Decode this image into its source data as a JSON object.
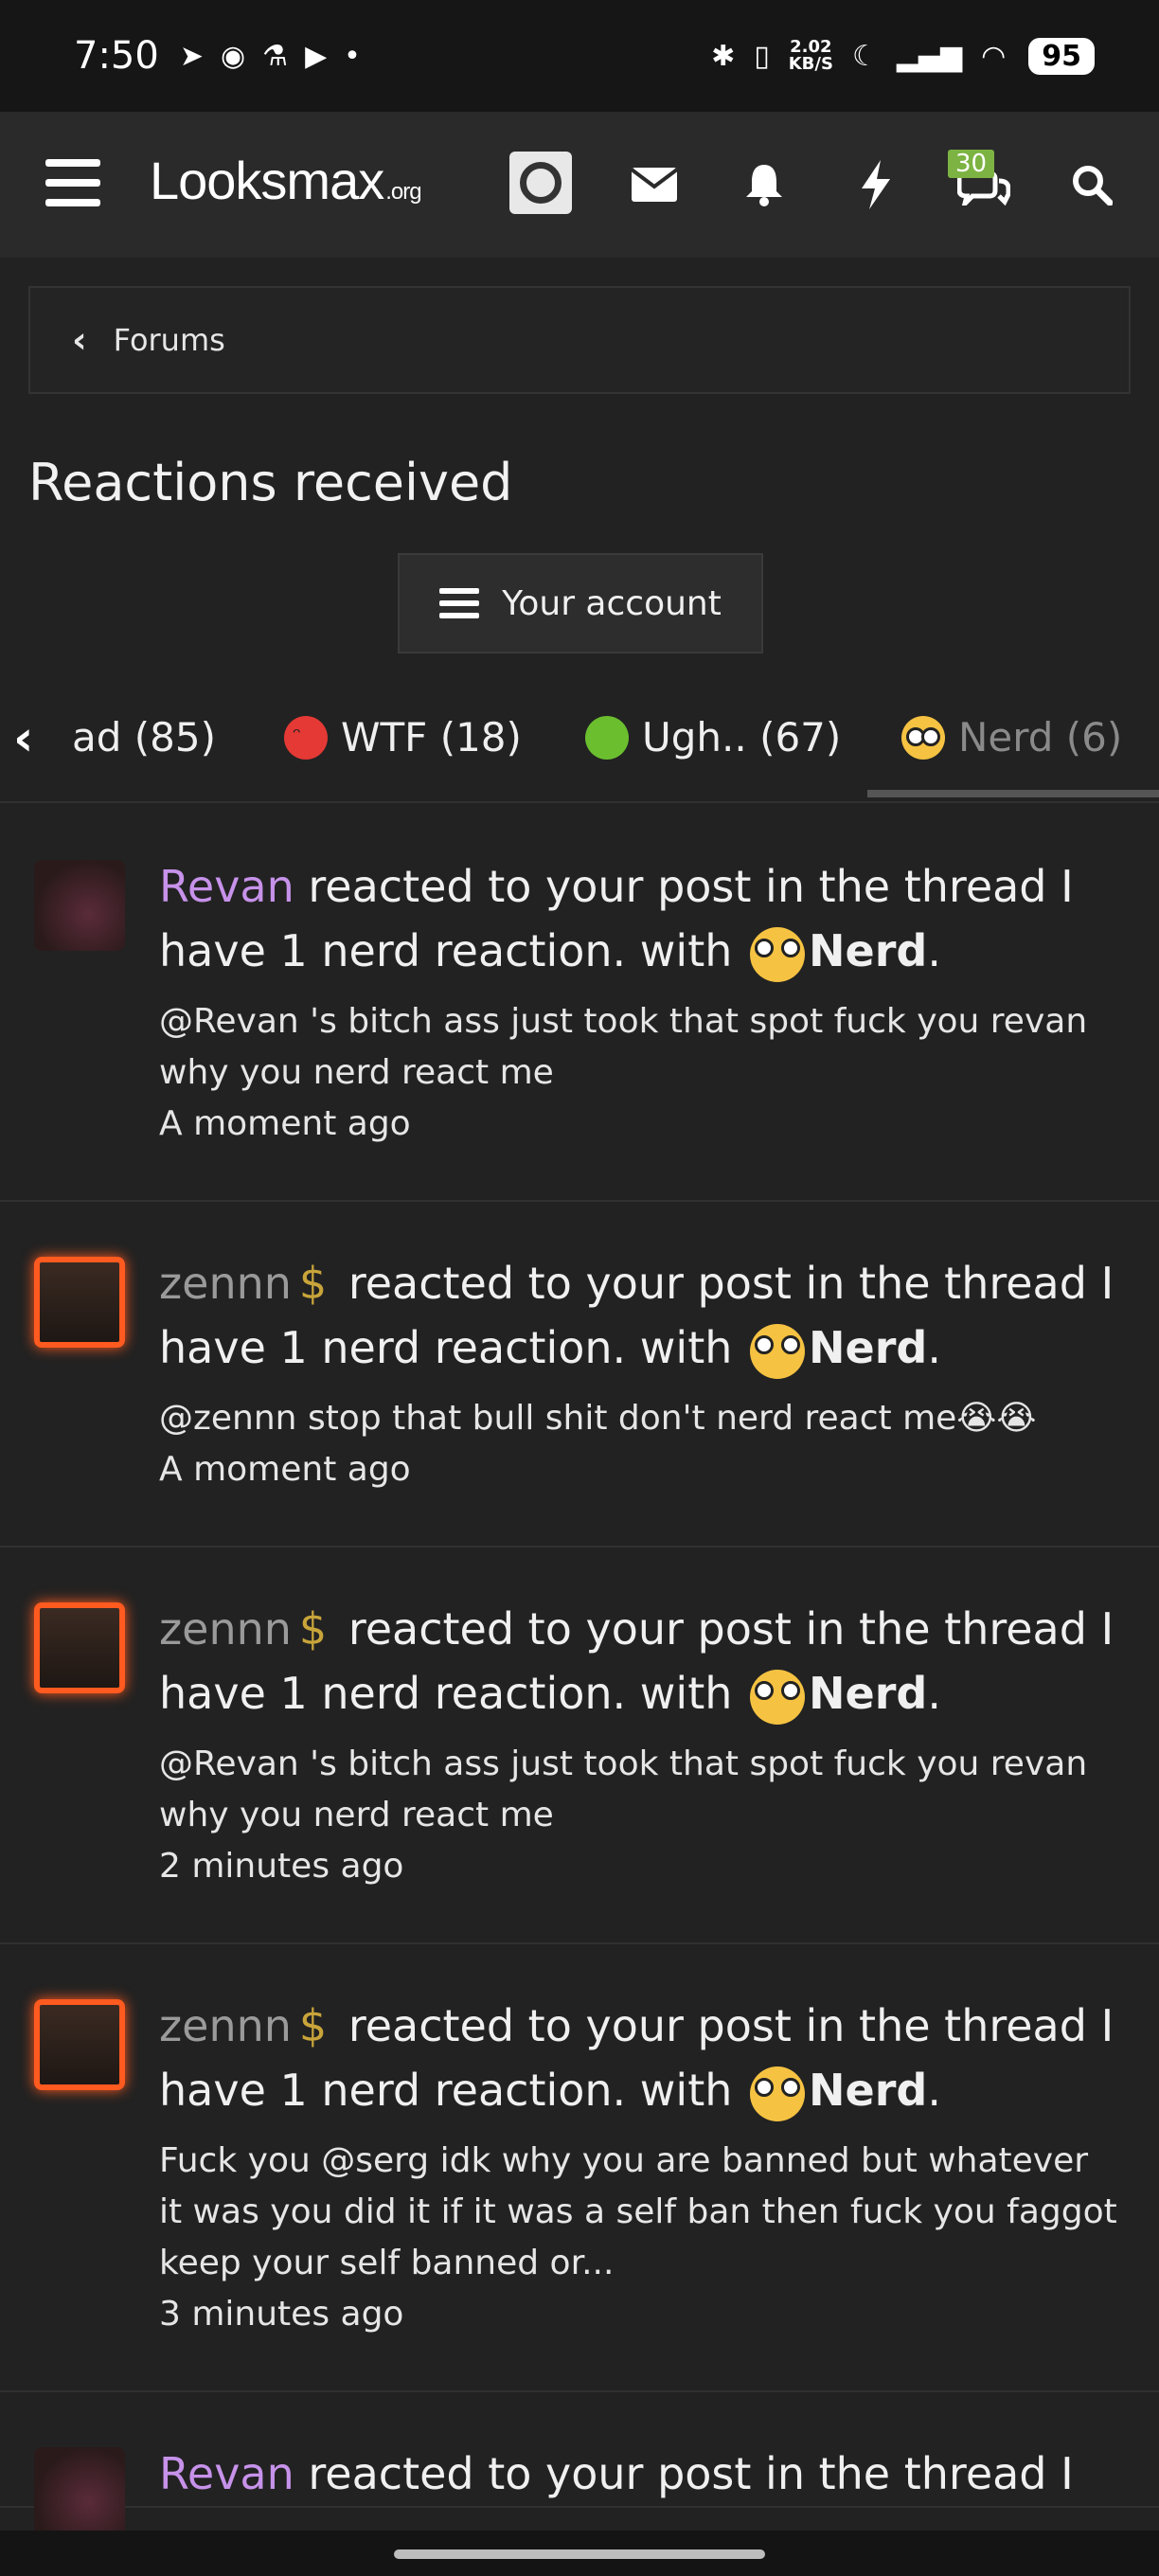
{
  "status_bar": {
    "time": "7:50",
    "net_speed_value": "2.02",
    "net_speed_unit": "KB/S",
    "battery": "95"
  },
  "navbar": {
    "logo_main": "Looksmax",
    "logo_suffix": ".org",
    "conversations_badge": "30"
  },
  "breadcrumb": {
    "label": "Forums"
  },
  "page_title": "Reactions received",
  "account_button": {
    "label": "Your account"
  },
  "tabs": [
    {
      "label": "ad (85)"
    },
    {
      "label": "WTF (18)"
    },
    {
      "label": "Ugh.. (67)"
    },
    {
      "label": "Nerd (6)"
    }
  ],
  "items": [
    {
      "user": "Revan",
      "text_before": "reacted to your post in the thread I have 1 nerd reaction. with",
      "reaction": "Nerd",
      "snippet": "@Revan 's bitch ass just took that spot fuck you revan why you nerd react me",
      "time": "A moment ago"
    },
    {
      "user": "zennn",
      "dollar": "$",
      "text_before": "reacted to your post in the thread I have 1 nerd reaction. with",
      "reaction": "Nerd",
      "snippet": "@zennn stop that bull shit don't nerd react me😭😭",
      "time": "A moment ago"
    },
    {
      "user": "zennn",
      "dollar": "$",
      "text_before": "reacted to your post in the thread I have 1 nerd reaction. with",
      "reaction": "Nerd",
      "snippet": "@Revan 's bitch ass just took that spot fuck you revan why you nerd react me",
      "time": "2 minutes ago"
    },
    {
      "user": "zennn",
      "dollar": "$",
      "text_before": "reacted to your post in the thread I have 1 nerd reaction. with",
      "reaction": "Nerd",
      "snippet": "Fuck you @serg idk why you are banned but whatever it was you did it if it was a self ban then fuck you faggot keep your self banned or...",
      "time": "3 minutes ago"
    },
    {
      "user": "Revan",
      "text_before": "reacted to your post in the thread I",
      "reaction": "",
      "snippet": "",
      "time": ""
    }
  ]
}
